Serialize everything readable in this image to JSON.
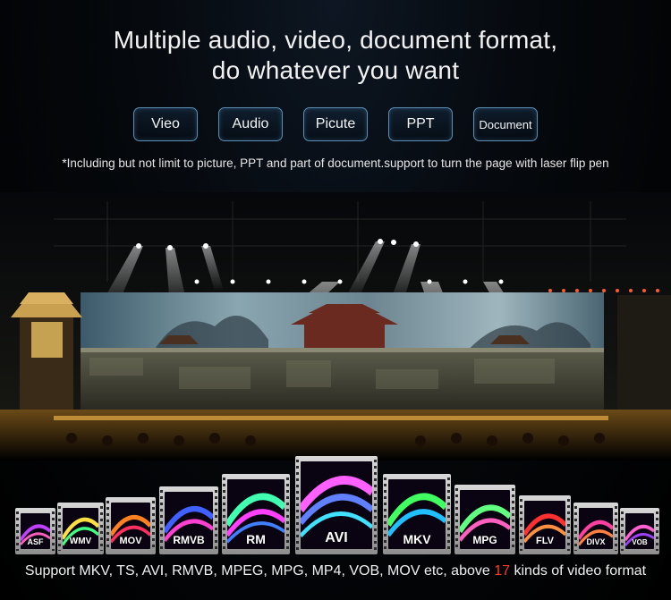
{
  "headline": {
    "line1": "Multiple audio, video, document format,",
    "line2": "do whatever you want"
  },
  "pills": [
    {
      "label": "Vieo"
    },
    {
      "label": "Audio"
    },
    {
      "label": "Picute"
    },
    {
      "label": "PPT"
    },
    {
      "label": "Document"
    }
  ],
  "note": "*Including but not limit to picture, PPT and part of document.support to turn the page with laser flip pen",
  "formats": [
    "ASF",
    "WMV",
    "MOV",
    "RMVB",
    "RM",
    "AVI",
    "MKV",
    "MPG",
    "FLV",
    "DIVX",
    "VOB"
  ],
  "footer": {
    "before": "Support MKV, TS, AVI, RMVB, MPEG, MPG, MP4, VOB, MOV etc, above",
    "count": "17",
    "after": "kinds of video format"
  },
  "colors": {
    "highlight": "#ff3b1f",
    "pill_border": "#5b8fb6"
  }
}
